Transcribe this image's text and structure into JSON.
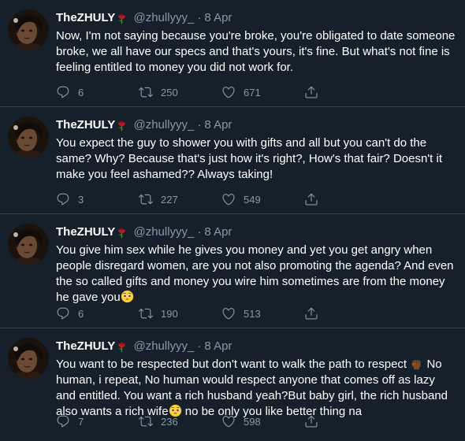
{
  "colors": {
    "background": "#15202b",
    "text": "#ffffff",
    "muted": "#8899a6",
    "divider": "#38444d"
  },
  "tweets": [
    {
      "name": "TheZHULY",
      "handle": "@zhullyyy_",
      "date": "8 Apr",
      "text": "Now, I'm not saying because you're broke, you're obligated to date someone broke, we all have our specs and that's yours, it's fine. But what's not fine is feeling entitled to money you did not work for.",
      "replies": "6",
      "retweets": "250",
      "likes": "671"
    },
    {
      "name": "TheZHULY",
      "handle": "@zhullyyy_",
      "date": "8 Apr",
      "text": "You expect the guy to shower you with gifts and all but you can't do the same? Why? Because that's just how it's right?, How's that fair? Doesn't it make you feel ashamed?? Always taking!",
      "replies": "3",
      "retweets": "227",
      "likes": "549"
    },
    {
      "name": "TheZHULY",
      "handle": "@zhullyyy_",
      "date": "8 Apr",
      "text": "You give him sex while he gives you money and yet you get angry when people disregard women, are you not also promoting the agenda? And even the so called gifts and money you wire him sometimes are from the money he gave you",
      "replies": "6",
      "retweets": "190",
      "likes": "513"
    },
    {
      "name": "TheZHULY",
      "handle": "@zhullyyy_",
      "date": "8 Apr",
      "text_a": "You want to be respected but don't want to walk the path to respect",
      "text_b": " No human, i repeat, No human would respect anyone that comes off as lazy and entitled. You want a rich husband yeah?But baby girl, the rich husband also wants a rich wife",
      "text_c": " no be only you like better thing na",
      "replies": "7",
      "retweets": "236",
      "likes": "598"
    }
  ]
}
